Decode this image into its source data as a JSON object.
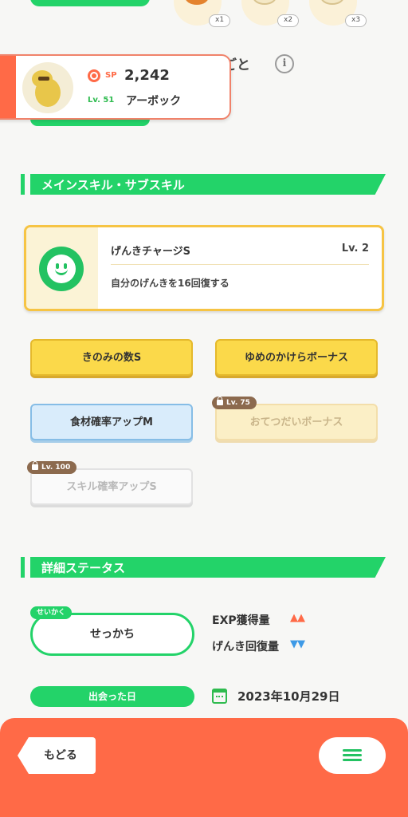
{
  "top": {
    "food_items": [
      {
        "icon": "food-item-icon",
        "quantity": "x1"
      },
      {
        "icon": "food-item-icon",
        "quantity": "x2"
      },
      {
        "icon": "food-item-icon",
        "quantity": "x3"
      }
    ],
    "partial_label": "ごと"
  },
  "pokemon_card": {
    "sp_label": "SP",
    "sp_value": "2,242",
    "level": "Lv. 51",
    "name": "アーボック",
    "accent_color": "#ff6a47"
  },
  "main_skill_section": {
    "title": "メインスキル・サブスキル",
    "main_skill": {
      "name": "げんきチャージS",
      "level": "Lv. 2",
      "description": "自分のげんきを16回復する",
      "icon": "smiley-icon"
    },
    "sub_skills": [
      {
        "label": "きのみの数S",
        "style": "gold",
        "locked": false
      },
      {
        "label": "ゆめのかけらボーナス",
        "style": "gold",
        "locked": false
      },
      {
        "label": "食材確率アップM",
        "style": "blue",
        "locked": false
      },
      {
        "label": "おてつだいボーナス",
        "style": "gold-dim",
        "locked": true,
        "lock_level": "Lv. 75"
      },
      {
        "label": "スキル確率アップS",
        "style": "white-dim",
        "locked": true,
        "lock_level": "Lv. 100"
      }
    ]
  },
  "detail_section": {
    "title": "詳細ステータス",
    "nature_tag": "せいかく",
    "nature": "せっかち",
    "stats": [
      {
        "label": "EXP獲得量",
        "arrows": "▲▲",
        "color": "#ff6a47"
      },
      {
        "label": "げんき回復量",
        "arrows": "▼▼",
        "color": "#3e9ae6"
      }
    ],
    "met_label": "出会った日",
    "met_date": "2023年10月29日"
  },
  "bottom_bar": {
    "back_label": "もどる",
    "menu_icon": "hamburger-menu-icon"
  }
}
